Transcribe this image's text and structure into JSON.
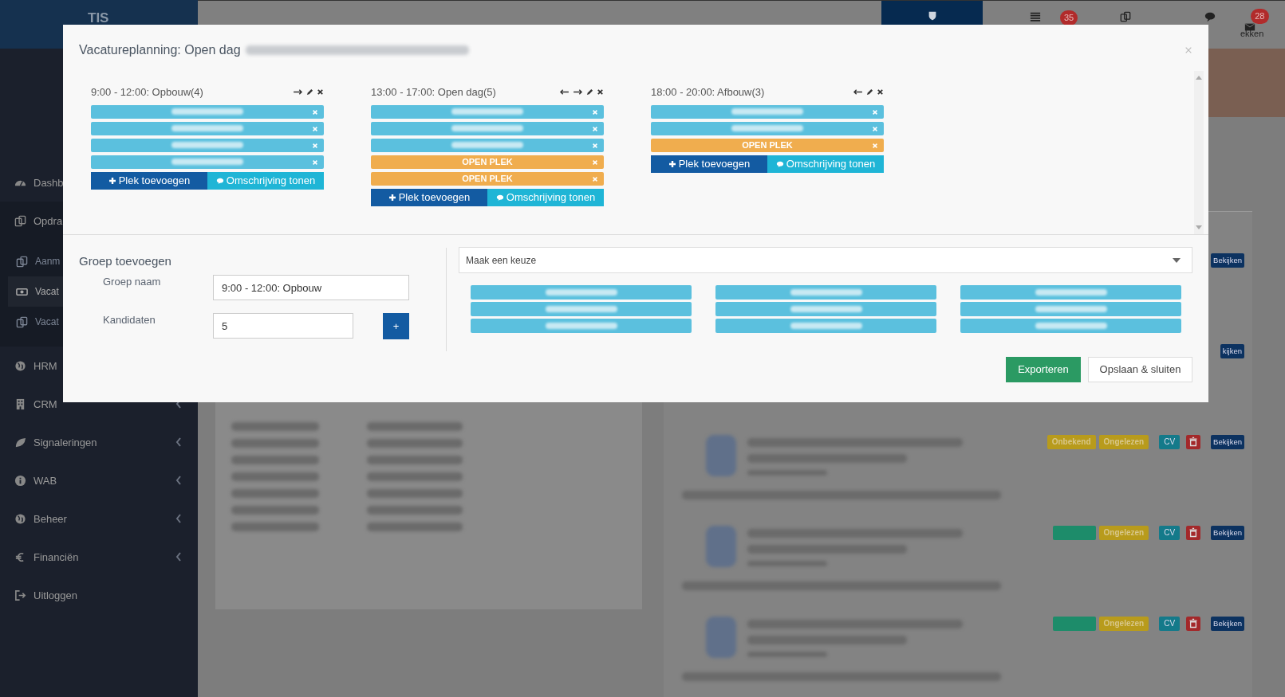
{
  "topbar": {
    "logo": "TIS",
    "badges": [
      {
        "count": "35"
      },
      {
        "count": "28"
      }
    ],
    "partial_label": "ekken"
  },
  "sidebar": {
    "items": [
      {
        "label": "Dashb"
      },
      {
        "label": "Opdra",
        "children": [
          {
            "label": "Aanm",
            "selected": false
          },
          {
            "label": "Vacat",
            "selected": true
          },
          {
            "label": "Vacat",
            "selected": false
          }
        ]
      },
      {
        "label": "HRM"
      },
      {
        "label": "CRM",
        "expandable": true
      },
      {
        "label": "Signaleringen",
        "expandable": true
      },
      {
        "label": "WAB",
        "expandable": true
      },
      {
        "label": "Beheer",
        "expandable": true
      },
      {
        "label": "Financiën",
        "expandable": true
      },
      {
        "label": "Uitloggen",
        "expandable": false
      }
    ]
  },
  "applications": [
    {
      "buttons": [
        "Bekijken"
      ]
    },
    {
      "buttons": [
        "kijken"
      ]
    },
    {
      "badges": [
        {
          "label": "Onbekend",
          "color": "#b89b1c"
        },
        {
          "label": "Ongelezen",
          "color": "#b89b1c"
        }
      ],
      "buttons": [
        "CV",
        "Bekijken"
      ],
      "details": true
    },
    {
      "badges": [
        {
          "color": "#1d8c6a"
        },
        {
          "label": "Ongelezen",
          "color": "#b89b1c"
        }
      ],
      "buttons": [
        "CV",
        "Bekijken"
      ],
      "details": true
    },
    {
      "badges": [
        {
          "color": "#1d8c6a"
        },
        {
          "label": "Ongelezen",
          "color": "#b89b1c"
        }
      ],
      "buttons": [
        "CV",
        "Bekijken"
      ],
      "details": true
    }
  ],
  "modal": {
    "title": "Vacatureplanning: Open dag",
    "groups": [
      {
        "title": "9:00 - 12:00: Opbouw(4)",
        "can_move_left": false,
        "can_move_right": true,
        "slots": [
          {
            "kind": "candidate"
          },
          {
            "kind": "candidate"
          },
          {
            "kind": "candidate"
          },
          {
            "kind": "candidate"
          }
        ],
        "add_label": "Plek toevoegen",
        "describe_label": "Omschrijving tonen"
      },
      {
        "title": "13:00 - 17:00: Open dag(5)",
        "can_move_left": true,
        "can_move_right": true,
        "slots": [
          {
            "kind": "candidate"
          },
          {
            "kind": "candidate"
          },
          {
            "kind": "candidate"
          },
          {
            "kind": "open",
            "label": "OPEN PLEK"
          },
          {
            "kind": "open",
            "label": "OPEN PLEK"
          }
        ],
        "add_label": "Plek toevoegen",
        "describe_label": "Omschrijving tonen"
      },
      {
        "title": "18:00 - 20:00: Afbouw(3)",
        "can_move_left": true,
        "can_move_right": false,
        "slots": [
          {
            "kind": "candidate"
          },
          {
            "kind": "candidate"
          },
          {
            "kind": "open",
            "label": "OPEN PLEK"
          }
        ],
        "add_label": "Plek toevoegen",
        "describe_label": "Omschrijving tonen"
      }
    ],
    "add_group": {
      "heading": "Groep toevoegen",
      "name_label": "Groep naam",
      "name_value": "9:00 - 12:00: Opbouw",
      "count_label": "Kandidaten",
      "count_value": "5",
      "plus_label": "+"
    },
    "select": {
      "value": "Maak een keuze"
    },
    "pool": [
      [
        {
          "kind": "candidate"
        },
        {
          "kind": "candidate"
        },
        {
          "kind": "candidate"
        }
      ],
      [
        {
          "kind": "candidate"
        },
        {
          "kind": "candidate"
        },
        {
          "kind": "candidate"
        }
      ],
      [
        {
          "kind": "candidate"
        },
        {
          "kind": "candidate"
        },
        {
          "kind": "candidate"
        }
      ]
    ],
    "buttons": {
      "export": "Exporteren",
      "save": "Opslaan & sluiten"
    }
  }
}
